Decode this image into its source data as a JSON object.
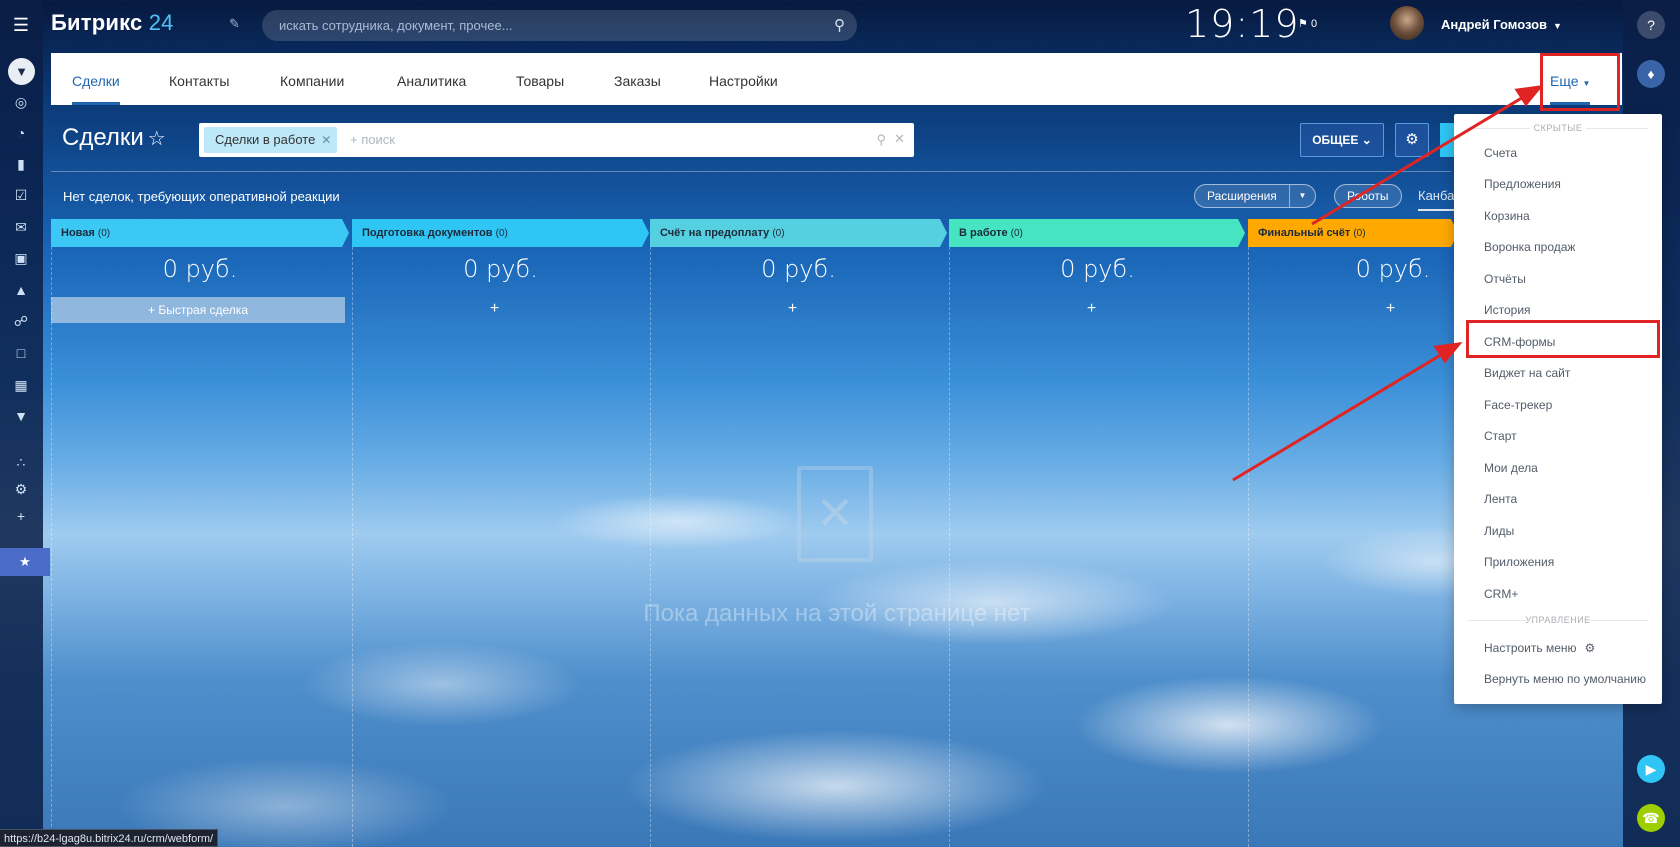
{
  "header": {
    "logo_text": "Битрикс",
    "logo_num": "24",
    "search_placeholder": "искать сотрудника, документ, прочее...",
    "clock": "19:19",
    "flag_count": "0",
    "user_name": "Андрей Гомозов"
  },
  "tabs": [
    {
      "label": "Сделки"
    },
    {
      "label": "Контакты"
    },
    {
      "label": "Компании"
    },
    {
      "label": "Аналитика"
    },
    {
      "label": "Товары"
    },
    {
      "label": "Заказы"
    },
    {
      "label": "Настройки"
    }
  ],
  "more_label": "Еще",
  "page": {
    "title": "Сделки",
    "filter_tag": "Сделки в работе",
    "filter_placeholder": "+ поиск",
    "common_button": "ОБЩЕЕ",
    "notice": "Нет сделок, требующих оперативной реакции",
    "extensions": "Расширения",
    "robots": "Роботы",
    "kanban": "Канба"
  },
  "stages": [
    {
      "name": "Новая",
      "count": "(0)",
      "sum": "0 руб.",
      "color": "#3bc8f5"
    },
    {
      "name": "Подготовка документов",
      "count": "(0)",
      "sum": "0 руб.",
      "color": "#2fc6f6"
    },
    {
      "name": "Счёт на предоплату",
      "count": "(0)",
      "sum": "0 руб.",
      "color": "#55d0e0"
    },
    {
      "name": "В работе",
      "count": "(0)",
      "sum": "0 руб.",
      "color": "#47e4c2"
    },
    {
      "name": "Финальный счёт",
      "count": "(0)",
      "sum": "0 руб.",
      "color": "#ffa900"
    }
  ],
  "quick_deal": "Быстрая сделка",
  "empty_text": "Пока данных на этой странице нет",
  "dropdown": {
    "hidden_label": "СКРЫТЫЕ",
    "items": [
      {
        "label": "Счета"
      },
      {
        "label": "Предложения"
      },
      {
        "label": "Корзина"
      },
      {
        "label": "Воронка продаж"
      },
      {
        "label": "Отчёты"
      },
      {
        "label": "История"
      },
      {
        "label": "CRM-формы"
      },
      {
        "label": "Виджет на сайт"
      },
      {
        "label": "Face-трекер"
      },
      {
        "label": "Старт"
      },
      {
        "label": "Мои дела"
      },
      {
        "label": "Лента"
      },
      {
        "label": "Лиды"
      },
      {
        "label": "Приложения"
      },
      {
        "label": "CRM+"
      }
    ],
    "manage_label": "УПРАВЛЕНИЕ",
    "configure": "Настроить меню",
    "reset": "Вернуть меню по умолчанию"
  },
  "status_url": "https://b24-lgag8u.bitrix24.ru/crm/webform/",
  "colors": {
    "accent": "#2067b0",
    "highlight": "#e02424"
  }
}
